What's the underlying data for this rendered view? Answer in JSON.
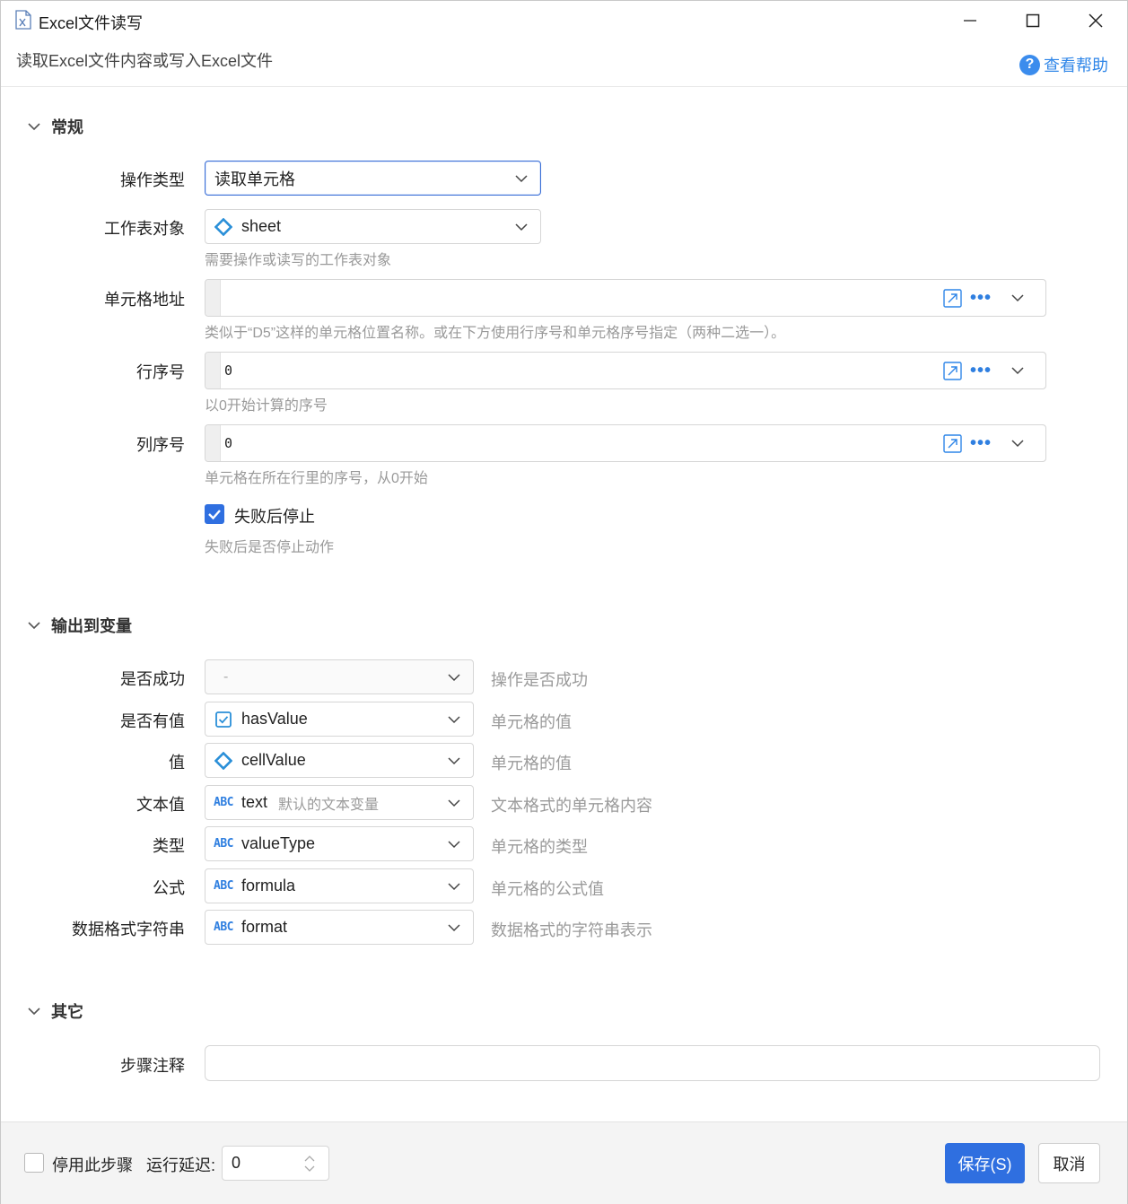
{
  "window": {
    "title": "Excel文件读写",
    "subtitle": "读取Excel文件内容或写入Excel文件",
    "help_label": "查看帮助"
  },
  "general": {
    "title": "常规",
    "op_type": {
      "label": "操作类型",
      "value": "读取单元格"
    },
    "sheet": {
      "label": "工作表对象",
      "value": "sheet",
      "hint": "需要操作或读写的工作表对象"
    },
    "cell_address": {
      "label": "单元格地址",
      "value": "",
      "hint": "类似于“D5”这样的单元格位置名称。或在下方使用行序号和单元格序号指定（两种二选一）。"
    },
    "row_index": {
      "label": "行序号",
      "value": "0",
      "hint": "以0开始计算的序号"
    },
    "col_index": {
      "label": "列序号",
      "value": "0",
      "hint": "单元格在所在行里的序号，从0开始"
    },
    "stop_on_fail": {
      "label": "失败后停止",
      "checked": true,
      "hint": "失败后是否停止动作"
    }
  },
  "output": {
    "title": "输出到变量",
    "rows": [
      {
        "label": "是否成功",
        "value": "-",
        "icon": "none",
        "tag": "",
        "desc": "操作是否成功"
      },
      {
        "label": "是否有值",
        "value": "hasValue",
        "icon": "checkbox-var-icon",
        "tag": "",
        "desc": "单元格的值"
      },
      {
        "label": "值",
        "value": "cellValue",
        "icon": "diamond-var-icon",
        "tag": "",
        "desc": "单元格的值"
      },
      {
        "label": "文本值",
        "value": "text",
        "icon": "abc-var-icon",
        "tag": "默认的文本变量",
        "desc": "文本格式的单元格内容"
      },
      {
        "label": "类型",
        "value": "valueType",
        "icon": "abc-var-icon",
        "tag": "",
        "desc": "单元格的类型"
      },
      {
        "label": "公式",
        "value": "formula",
        "icon": "abc-var-icon",
        "tag": "",
        "desc": "单元格的公式值"
      },
      {
        "label": "数据格式字符串",
        "value": "format",
        "icon": "abc-var-icon",
        "tag": "",
        "desc": "数据格式的字符串表示"
      }
    ]
  },
  "other": {
    "title": "其它",
    "note": {
      "label": "步骤注释",
      "value": ""
    }
  },
  "footer": {
    "disable_step": {
      "label": "停用此步骤",
      "checked": false
    },
    "delay": {
      "label": "运行延迟:",
      "value": "0"
    },
    "save_label": "保存(S)",
    "cancel_label": "取消"
  },
  "colors": {
    "accent": "#2f6fe0",
    "link": "#2f86e8",
    "hint": "#9a9a9a"
  }
}
